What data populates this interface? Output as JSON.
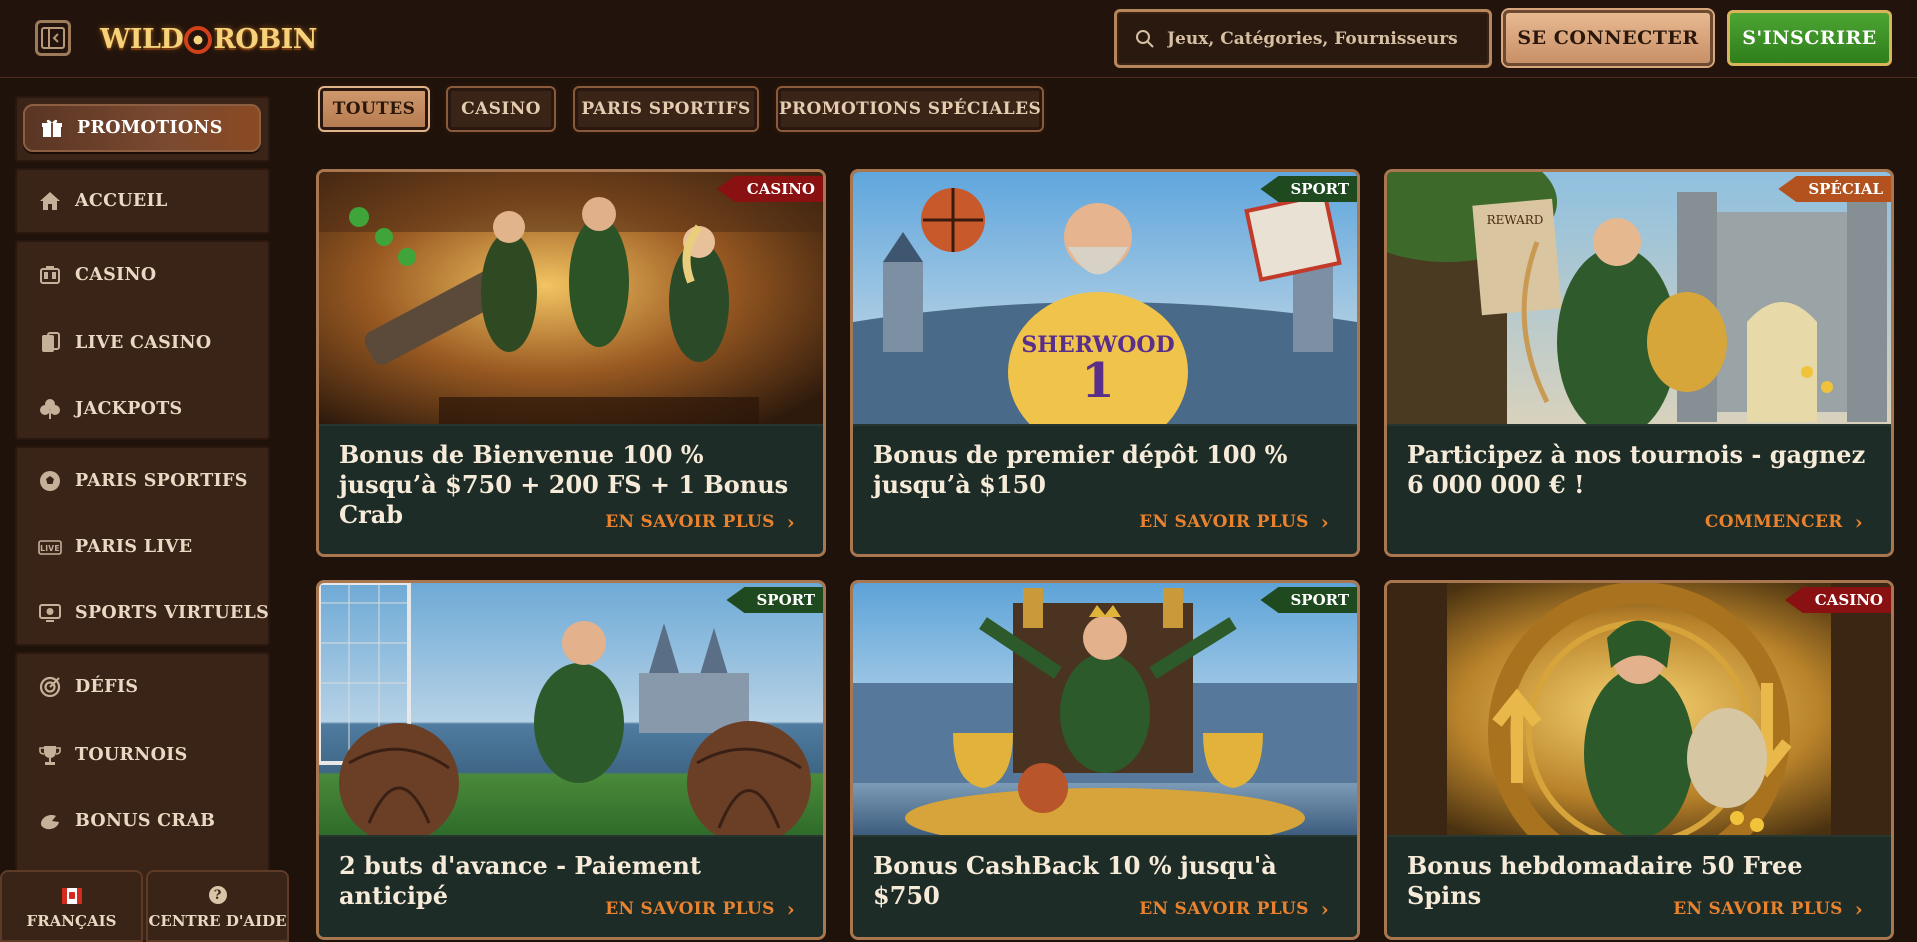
{
  "header": {
    "logo_text_left": "WILD",
    "logo_text_right": "ROBIN",
    "search_placeholder": "Jeux, Catégories, Fournisseurs",
    "login_label": "SE CONNECTER",
    "signup_label": "S'INSCRIRE"
  },
  "sidebar": {
    "items": [
      {
        "label": "PROMOTIONS",
        "icon": "gift-icon"
      },
      {
        "label": "ACCUEIL",
        "icon": "home-icon"
      },
      {
        "label": "CASINO",
        "icon": "casino-icon"
      },
      {
        "label": "LIVE CASINO",
        "icon": "cards-icon"
      },
      {
        "label": "JACKPOTS",
        "icon": "clover-icon"
      },
      {
        "label": "PARIS SPORTIFS",
        "icon": "soccer-ball-icon"
      },
      {
        "label": "PARIS LIVE",
        "icon": "live-icon"
      },
      {
        "label": "SPORTS VIRTUELS",
        "icon": "virtual-sports-icon"
      },
      {
        "label": "DÉFIS",
        "icon": "target-icon"
      },
      {
        "label": "TOURNOIS",
        "icon": "trophy-icon"
      },
      {
        "label": "BONUS CRAB",
        "icon": "crab-icon"
      }
    ],
    "footer": {
      "language_label": "FRANÇAIS",
      "help_label": "CENTRE D'AIDE",
      "help_glyph": "?"
    }
  },
  "tabs": [
    {
      "label": "TOUTES",
      "active": true
    },
    {
      "label": "CASINO",
      "active": false
    },
    {
      "label": "PARIS SPORTIFS",
      "active": false
    },
    {
      "label": "PROMOTIONS SPÉCIALES",
      "active": false
    }
  ],
  "cards": [
    {
      "badge": "CASINO",
      "title": "Bonus de Bienvenue 100 % jusqu’à $750 + 200 FS + 1 Bonus Crab",
      "cta": "EN SAVOIR PLUS"
    },
    {
      "badge": "SPORT",
      "title": "Bonus de premier dépôt 100 % jusqu’à $150",
      "cta": "EN SAVOIR PLUS"
    },
    {
      "badge": "SPÉCIAL",
      "title": "Participez à nos tournois - gagnez 6 000 000 € !",
      "cta": "COMMENCER"
    },
    {
      "badge": "SPORT",
      "title": "2 buts d'avance - Paiement anticipé",
      "cta": "EN SAVOIR PLUS"
    },
    {
      "badge": "SPORT",
      "title": "Bonus CashBack 10 % jusqu'à $750",
      "cta": "EN SAVOIR PLUS"
    },
    {
      "badge": "CASINO",
      "title": "Bonus hebdomadaire 50 Free Spins",
      "cta": "EN SAVOIR PLUS"
    }
  ],
  "chevron": "›",
  "colors": {
    "accent_orange": "#e8822e",
    "signup_green": "#3a9226",
    "badge_casino": "#8a1111",
    "badge_sport": "#1f4a1f",
    "badge_special": "#b3521e"
  }
}
